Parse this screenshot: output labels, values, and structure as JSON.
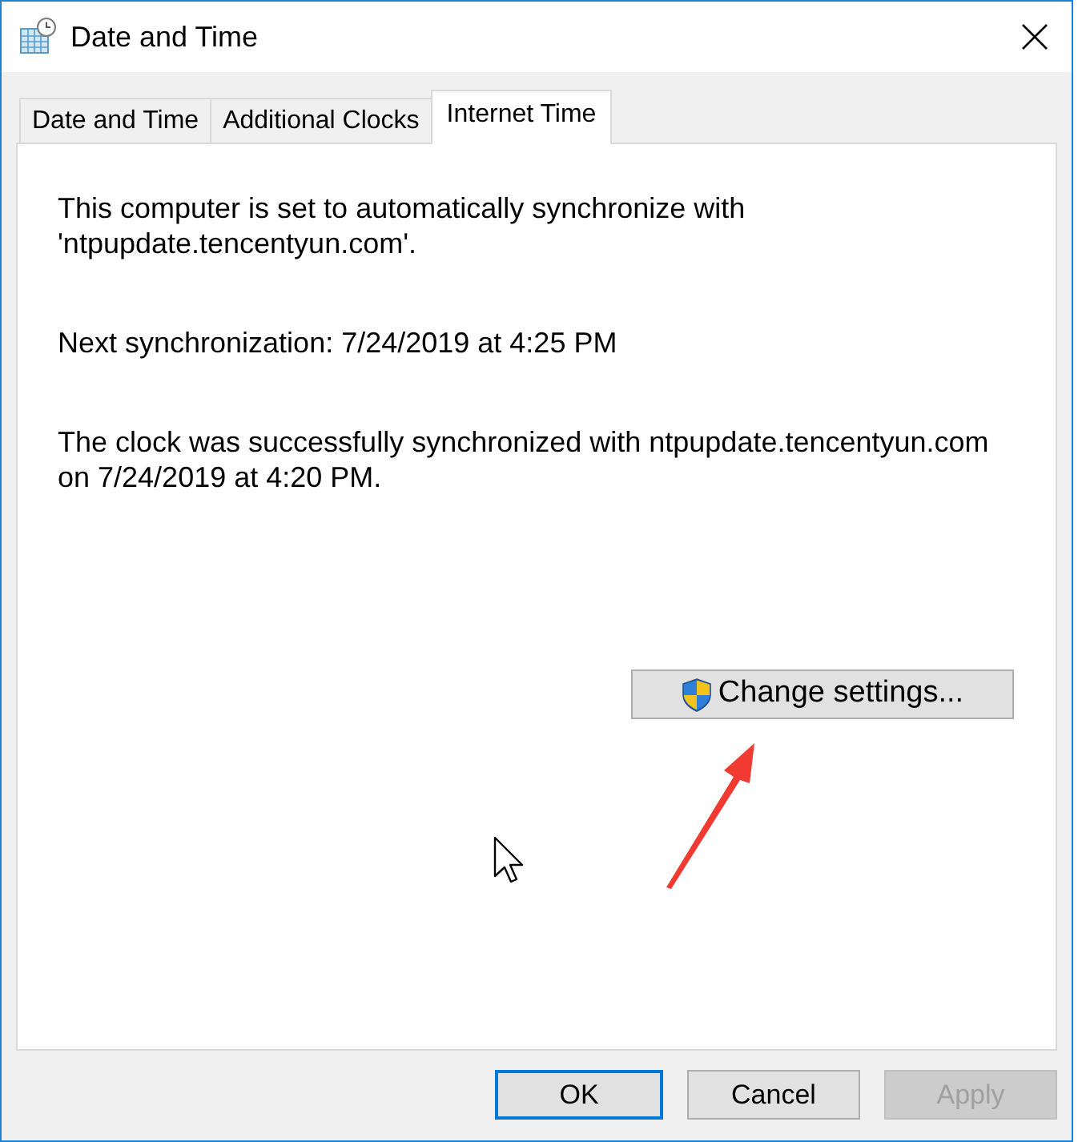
{
  "window": {
    "title": "Date and Time"
  },
  "tabs": [
    {
      "label": "Date and Time",
      "selected": false
    },
    {
      "label": "Additional Clocks",
      "selected": false
    },
    {
      "label": "Internet Time",
      "selected": true
    }
  ],
  "paragraphs": [
    {
      "lines": [
        "This computer is set to automatically synchronize with",
        "'ntpupdate.tencentyun.com'."
      ]
    },
    {
      "lines": [
        "Next synchronization: 7/24/2019 at 4:25 PM"
      ]
    },
    {
      "lines": [
        "The clock was successfully synchronized with ntpupdate.tencentyun.com",
        "on 7/24/2019 at 4:20 PM."
      ]
    }
  ],
  "change_settings_button": {
    "label": "Change settings..."
  },
  "buttons": [
    {
      "label": "OK",
      "default": true,
      "disabled": false
    },
    {
      "label": "Cancel",
      "default": false,
      "disabled": false
    },
    {
      "label": "Apply",
      "default": false,
      "disabled": true
    }
  ]
}
